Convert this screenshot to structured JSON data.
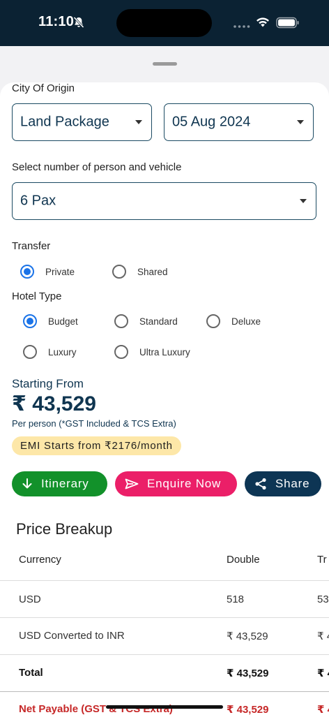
{
  "status_bar": {
    "time": "11:10"
  },
  "form": {
    "city_label": "City Of Origin",
    "package_select": "Land Package",
    "date_select": "05 Aug 2024",
    "pax_label": "Select number of person and vehicle",
    "pax_select": "6 Pax",
    "transfer_label": "Transfer",
    "transfer_options": [
      {
        "label": "Private",
        "selected": true
      },
      {
        "label": "Shared",
        "selected": false
      }
    ],
    "hotel_label": "Hotel Type",
    "hotel_options": [
      {
        "label": "Budget",
        "selected": true
      },
      {
        "label": "Standard",
        "selected": false
      },
      {
        "label": "Deluxe",
        "selected": false
      },
      {
        "label": "Luxury",
        "selected": false
      },
      {
        "label": "Ultra Luxury",
        "selected": false
      }
    ]
  },
  "pricing": {
    "starting_from": "Starting From",
    "price": "₹ 43,529",
    "per_person": "Per person (*GST Included & TCS Extra)",
    "emi": "EMI Starts from ₹2176/month"
  },
  "actions": {
    "itinerary": "Itinerary",
    "enquire": "Enquire Now",
    "share": "Share"
  },
  "price_breakup": {
    "title": "Price Breakup",
    "columns": [
      "Currency",
      "Double",
      "Tr"
    ],
    "rows": [
      [
        "USD",
        "518",
        "53"
      ],
      [
        "USD Converted to INR",
        "₹ 43,529",
        "₹ 4"
      ],
      [
        "Total",
        "₹ 43,529",
        "₹ 4"
      ],
      [
        "Net Payable (GST & TCS Extra)",
        "₹ 43,529",
        "₹ 4"
      ]
    ]
  },
  "colors": {
    "navy": "#0d3554",
    "green": "#12912a",
    "pink": "#eb1f68",
    "emi_bg": "#fde7a8",
    "radio_active": "#1a73e8",
    "net_payable": "#c62828"
  }
}
